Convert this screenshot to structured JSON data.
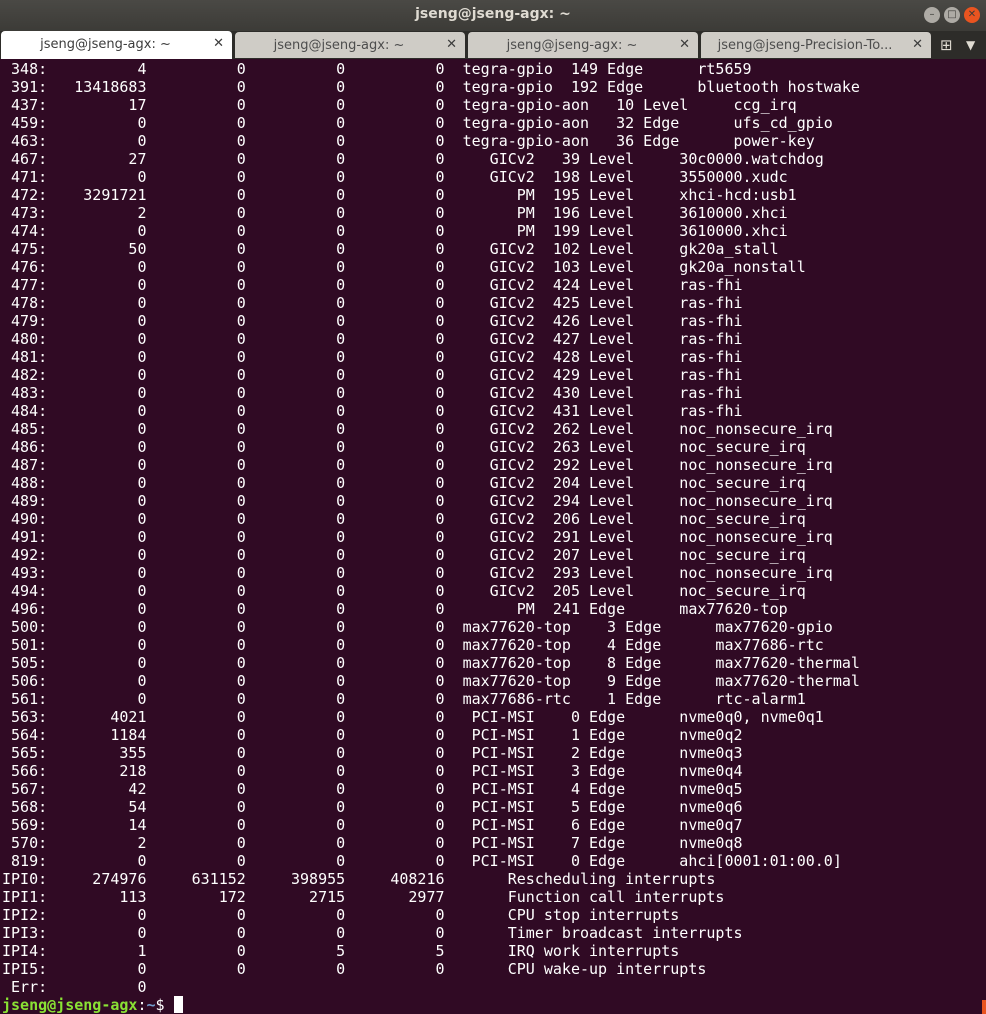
{
  "window": {
    "title": "jseng@jseng-agx: ~",
    "buttons": [
      "minimize",
      "maximize",
      "close"
    ]
  },
  "tabs": [
    {
      "label": "jseng@jseng-agx: ~",
      "active": true
    },
    {
      "label": "jseng@jseng-agx: ~",
      "active": false
    },
    {
      "label": "jseng@jseng-agx: ~",
      "active": false
    },
    {
      "label": "jseng@jseng-Precision-To...",
      "active": false
    }
  ],
  "tab_close_glyph": "✕",
  "terminal": {
    "lines": [
      " 348:          4          0          0          0  tegra-gpio  149 Edge      rt5659",
      " 391:   13418683          0          0          0  tegra-gpio  192 Edge      bluetooth hostwake",
      " 437:         17          0          0          0  tegra-gpio-aon   10 Level     ccg_irq",
      " 459:          0          0          0          0  tegra-gpio-aon   32 Edge      ufs_cd_gpio",
      " 463:          0          0          0          0  tegra-gpio-aon   36 Edge      power-key",
      " 467:         27          0          0          0     GICv2   39 Level     30c0000.watchdog",
      " 471:          0          0          0          0     GICv2  198 Level     3550000.xudc",
      " 472:    3291721          0          0          0        PM  195 Level     xhci-hcd:usb1",
      " 473:          2          0          0          0        PM  196 Level     3610000.xhci",
      " 474:          0          0          0          0        PM  199 Level     3610000.xhci",
      " 475:         50          0          0          0     GICv2  102 Level     gk20a_stall",
      " 476:          0          0          0          0     GICv2  103 Level     gk20a_nonstall",
      " 477:          0          0          0          0     GICv2  424 Level     ras-fhi",
      " 478:          0          0          0          0     GICv2  425 Level     ras-fhi",
      " 479:          0          0          0          0     GICv2  426 Level     ras-fhi",
      " 480:          0          0          0          0     GICv2  427 Level     ras-fhi",
      " 481:          0          0          0          0     GICv2  428 Level     ras-fhi",
      " 482:          0          0          0          0     GICv2  429 Level     ras-fhi",
      " 483:          0          0          0          0     GICv2  430 Level     ras-fhi",
      " 484:          0          0          0          0     GICv2  431 Level     ras-fhi",
      " 485:          0          0          0          0     GICv2  262 Level     noc_nonsecure_irq",
      " 486:          0          0          0          0     GICv2  263 Level     noc_secure_irq",
      " 487:          0          0          0          0     GICv2  292 Level     noc_nonsecure_irq",
      " 488:          0          0          0          0     GICv2  204 Level     noc_secure_irq",
      " 489:          0          0          0          0     GICv2  294 Level     noc_nonsecure_irq",
      " 490:          0          0          0          0     GICv2  206 Level     noc_secure_irq",
      " 491:          0          0          0          0     GICv2  291 Level     noc_nonsecure_irq",
      " 492:          0          0          0          0     GICv2  207 Level     noc_secure_irq",
      " 493:          0          0          0          0     GICv2  293 Level     noc_nonsecure_irq",
      " 494:          0          0          0          0     GICv2  205 Level     noc_secure_irq",
      " 496:          0          0          0          0        PM  241 Edge      max77620-top",
      " 500:          0          0          0          0  max77620-top    3 Edge      max77620-gpio",
      " 501:          0          0          0          0  max77620-top    4 Edge      max77686-rtc",
      " 505:          0          0          0          0  max77620-top    8 Edge      max77620-thermal",
      " 506:          0          0          0          0  max77620-top    9 Edge      max77620-thermal",
      " 561:          0          0          0          0  max77686-rtc    1 Edge      rtc-alarm1",
      " 563:       4021          0          0          0   PCI-MSI    0 Edge      nvme0q0, nvme0q1",
      " 564:       1184          0          0          0   PCI-MSI    1 Edge      nvme0q2",
      " 565:        355          0          0          0   PCI-MSI    2 Edge      nvme0q3",
      " 566:        218          0          0          0   PCI-MSI    3 Edge      nvme0q4",
      " 567:         42          0          0          0   PCI-MSI    4 Edge      nvme0q5",
      " 568:         54          0          0          0   PCI-MSI    5 Edge      nvme0q6",
      " 569:         14          0          0          0   PCI-MSI    6 Edge      nvme0q7",
      " 570:          2          0          0          0   PCI-MSI    7 Edge      nvme0q8",
      " 819:          0          0          0          0   PCI-MSI    0 Edge      ahci[0001:01:00.0]",
      "IPI0:     274976     631152     398955     408216       Rescheduling interrupts",
      "IPI1:        113        172       2715       2977       Function call interrupts",
      "IPI2:          0          0          0          0       CPU stop interrupts",
      "IPI3:          0          0          0          0       Timer broadcast interrupts",
      "IPI4:          1          0          5          5       IRQ work interrupts",
      "IPI5:          0          0          0          0       CPU wake-up interrupts",
      " Err:          0"
    ],
    "prompt": {
      "user_host": "jseng@jseng-agx",
      "colon": ":",
      "dir": "~",
      "symbol": "$ "
    }
  },
  "colors": {
    "background": "#300a24",
    "prompt_user": "#8ae234",
    "prompt_dir": "#729fcf",
    "close_button": "#e95420"
  }
}
